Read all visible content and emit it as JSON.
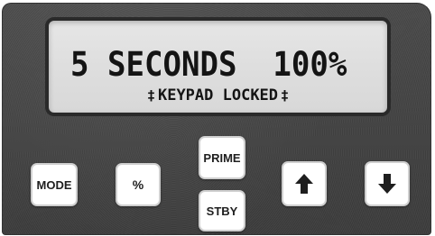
{
  "display": {
    "duration_text": "5 SECONDS",
    "percent_text": "100%",
    "lock_glyph": "‡",
    "status_text": "KEYPAD LOCKED"
  },
  "buttons": {
    "mode": "MODE",
    "percent": "%",
    "prime": "PRIME",
    "standby": "STBY",
    "up_icon": "arrow-up-icon",
    "down_icon": "arrow-down-icon"
  },
  "colors": {
    "panel": "#444444",
    "lcd_background": "#dedede",
    "lcd_text": "#141414",
    "button_face": "#ffffff",
    "button_text": "#202020"
  }
}
